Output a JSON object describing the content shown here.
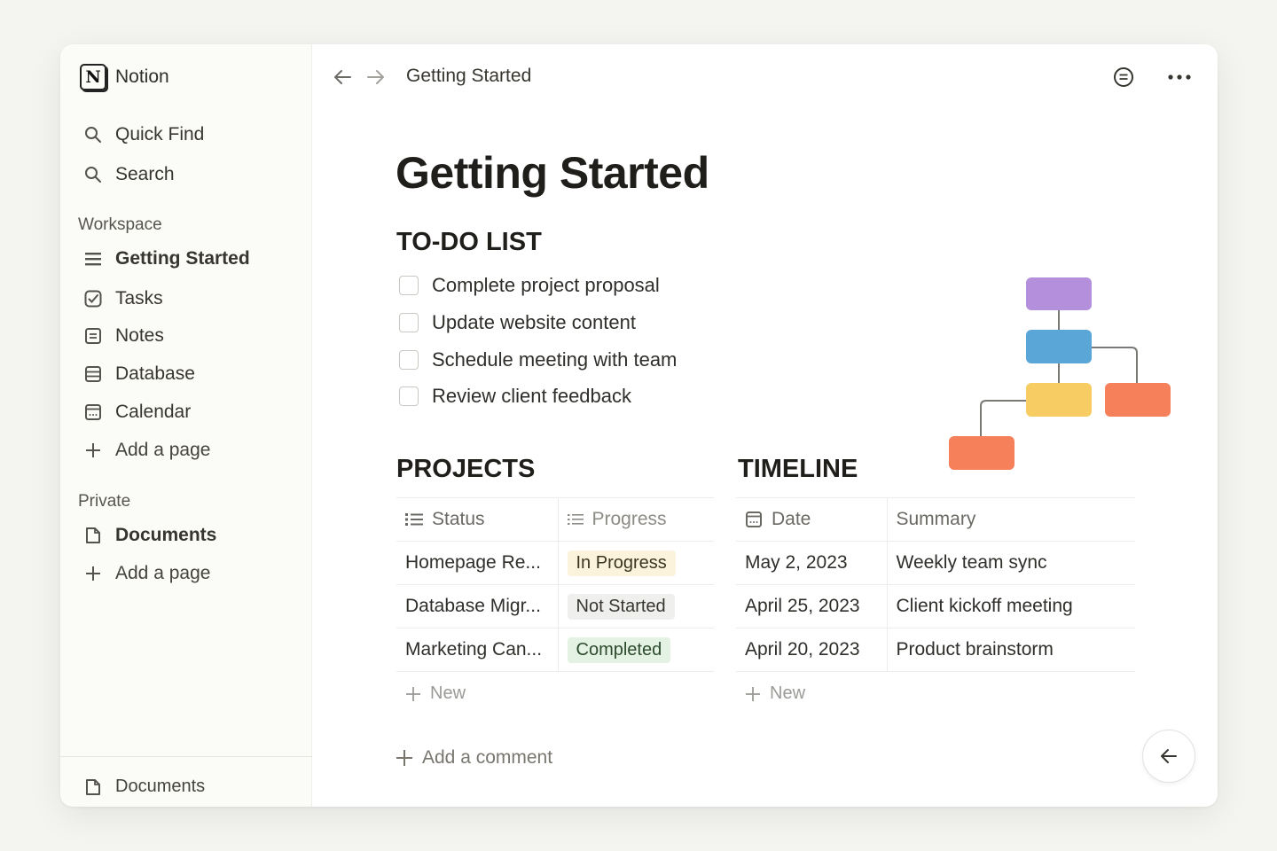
{
  "sidebar": {
    "app_name": "Notion",
    "quick_find": "Quick Find",
    "search": "Search",
    "workspace_label": "Workspace",
    "workspace_items": [
      {
        "label": "Getting Started",
        "icon": "list-icon"
      },
      {
        "label": "Tasks",
        "icon": "checkbox-icon"
      },
      {
        "label": "Notes",
        "icon": "note-icon"
      },
      {
        "label": "Database",
        "icon": "database-icon"
      },
      {
        "label": "Calendar",
        "icon": "calendar-icon"
      }
    ],
    "add_page": "Add a page",
    "private_label": "Private",
    "private_items": [
      {
        "label": "Documents",
        "icon": "document-icon"
      }
    ],
    "footer_item": "Documents"
  },
  "topbar": {
    "breadcrumb": "Getting Started"
  },
  "page": {
    "title": "Getting Started",
    "todo_heading": "TO-DO LIST",
    "todos": [
      "Complete project proposal",
      "Update website content",
      "Schedule meeting with team",
      "Review client feedback"
    ],
    "projects_heading": "PROJECTS",
    "projects_columns": [
      "Status",
      "Progress"
    ],
    "projects_rows": [
      {
        "name": "Homepage Re...",
        "progress": "In Progress"
      },
      {
        "name": "Database Migr...",
        "progress": "Not Started"
      },
      {
        "name": "Marketing Can...",
        "progress": "Completed"
      }
    ],
    "timeline_heading": "TIMELINE",
    "timeline_columns": [
      "Date",
      "Summary"
    ],
    "timeline_rows": [
      {
        "date": "May 2, 2023",
        "summary": "Weekly team sync"
      },
      {
        "date": "April 25, 2023",
        "summary": "Client kickoff meeting"
      },
      {
        "date": "April 20, 2023",
        "summary": "Product brainstorm"
      }
    ],
    "new_label": "New",
    "add_comment": "Add a comment"
  },
  "colors": {
    "diagram_purple": "#b48fdb",
    "diagram_blue": "#5aa6d6",
    "diagram_yellow": "#f7cc62",
    "diagram_orange": "#f5805a"
  }
}
